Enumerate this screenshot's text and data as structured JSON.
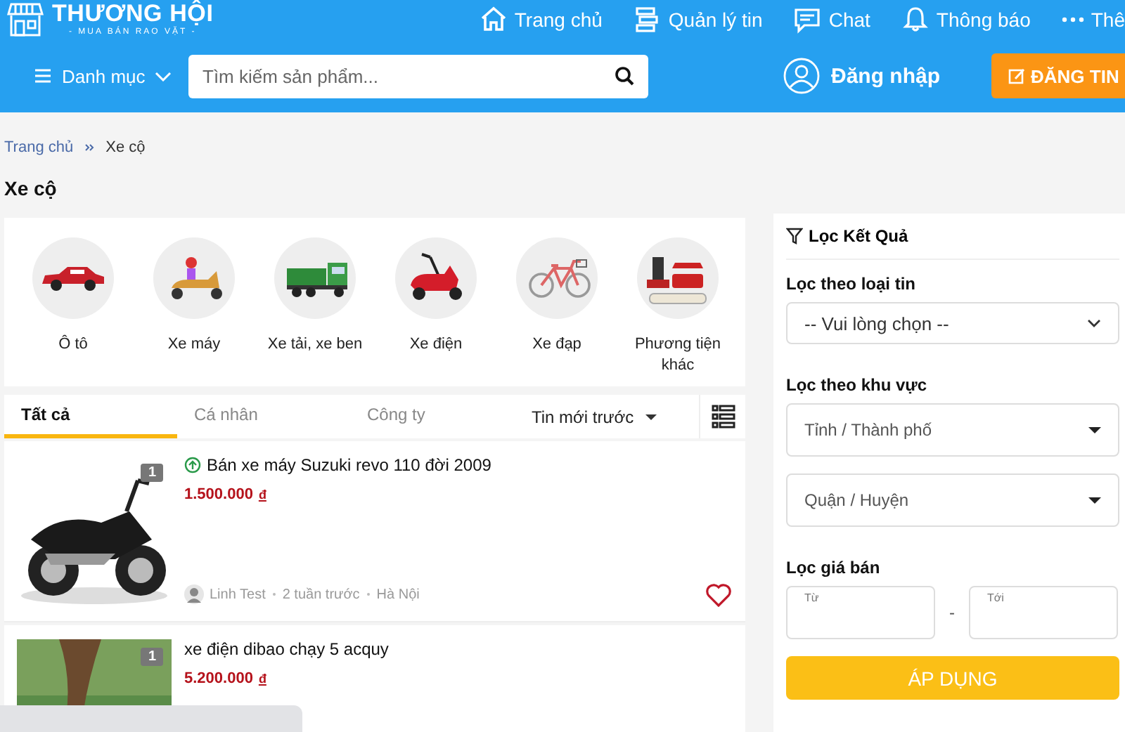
{
  "header": {
    "logo": {
      "title": "THƯƠNG HỘI",
      "tagline": "- MUA BÁN RAO VẶT -"
    },
    "nav": [
      {
        "label": "Trang chủ",
        "kind": "home"
      },
      {
        "label": "Quản lý tin",
        "kind": "list"
      },
      {
        "label": "Chat",
        "kind": "chat"
      },
      {
        "label": "Thông báo",
        "kind": "bell"
      },
      {
        "label": "Thê",
        "kind": "more"
      }
    ],
    "menu": "Danh mục",
    "search": {
      "placeholder": "Tìm kiếm sản phẩm..."
    },
    "login": "Đăng nhập",
    "post_button": "ĐĂNG TIN"
  },
  "breadcrumb": [
    "Trang chủ",
    "Xe cộ"
  ],
  "page_title": "Xe cộ",
  "categories": [
    {
      "label": "Ô tô",
      "kind": "car"
    },
    {
      "label": "Xe máy",
      "kind": "scooter"
    },
    {
      "label": "Xe tải, xe ben",
      "kind": "truck"
    },
    {
      "label": "Xe điện",
      "kind": "escooter"
    },
    {
      "label": "Xe đạp",
      "kind": "bicycle"
    },
    {
      "label": "Phương tiện khác",
      "kind": "mixed"
    }
  ],
  "tabs": [
    {
      "label": "Tất cả",
      "selected": true
    },
    {
      "label": "Cá nhân",
      "selected": false
    },
    {
      "label": "Công ty",
      "selected": false
    }
  ],
  "sort": "Tin mới trước",
  "listings": [
    {
      "title": "Bán xe máy Suzuki revo 110 đời 2009",
      "promoted": true,
      "price": "1.500.000",
      "currency": "đ",
      "photo_count": "1",
      "seller": "Linh Test",
      "time": "2 tuần trước",
      "location": "Hà Nội"
    },
    {
      "title": "xe điện dibao chạy 5 acquy",
      "promoted": false,
      "price": "5.200.000",
      "currency": "đ",
      "photo_count": "1"
    }
  ],
  "filter": {
    "title": "Lọc Kết Quả",
    "type_label": "Lọc theo loại tin",
    "type_select": "-- Vui lòng chọn --",
    "area_label": "Lọc theo khu vực",
    "area_selects": [
      {
        "placeholder": "Tỉnh / Thành phố"
      },
      {
        "placeholder": "Quận / Huyện"
      }
    ],
    "price_label": "Lọc giá bán",
    "price_from": {
      "placeholder": "Từ"
    },
    "price_separator": "-",
    "price_to": {
      "placeholder": "Tới"
    },
    "apply_button": "ÁP DỤNG"
  }
}
